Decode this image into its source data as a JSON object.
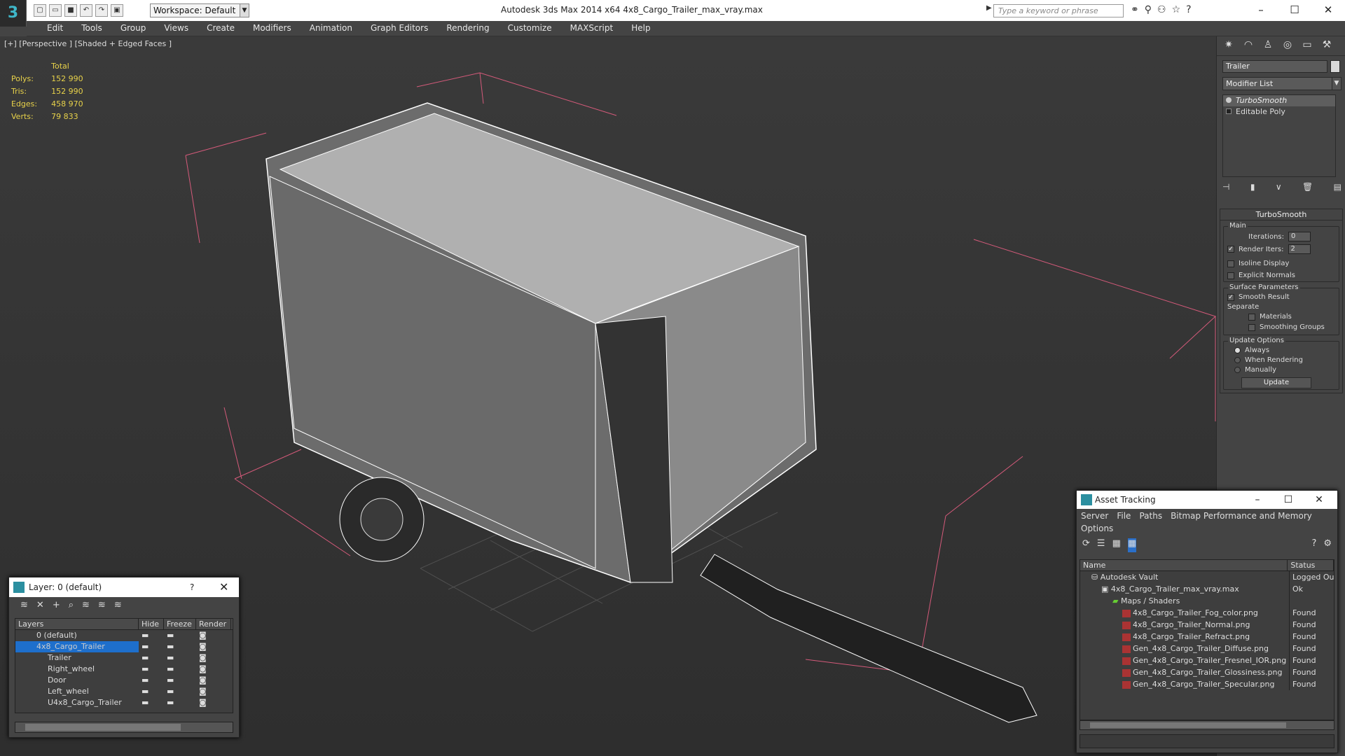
{
  "app": {
    "logo_glyph": "3",
    "title": "Autodesk 3ds Max  2014 x64      4x8_Cargo_Trailer_max_vray.max",
    "workspace": "Workspace: Default",
    "search_placeholder": "Type a keyword or phrase"
  },
  "menu": [
    "Edit",
    "Tools",
    "Group",
    "Views",
    "Create",
    "Modifiers",
    "Animation",
    "Graph Editors",
    "Rendering",
    "Customize",
    "MAXScript",
    "Help"
  ],
  "viewport": {
    "label": "[+] [Perspective ] [Shaded + Edged Faces ]",
    "stats": {
      "header": "Total",
      "rows": [
        {
          "label": "Polys:",
          "value": "152 990"
        },
        {
          "label": "Tris:",
          "value": "152 990"
        },
        {
          "label": "Edges:",
          "value": "458 970"
        },
        {
          "label": "Verts:",
          "value": "79 833"
        }
      ]
    }
  },
  "command_panel": {
    "object_name": "Trailer",
    "modifier_list": "Modifier List",
    "stack": [
      "TurboSmooth",
      "Editable Poly"
    ],
    "rollout_title": "TurboSmooth",
    "main_label": "Main",
    "iterations_label": "Iterations:",
    "iterations_value": "0",
    "render_iters_label": "Render Iters:",
    "render_iters_value": "2",
    "isoline_label": "Isoline Display",
    "explicit_normals_label": "Explicit Normals",
    "surface_params_label": "Surface Parameters",
    "smooth_result_label": "Smooth Result",
    "separate_label": "Separate",
    "materials_label": "Materials",
    "smoothing_groups_label": "Smoothing Groups",
    "update_options_label": "Update Options",
    "always_label": "Always",
    "when_rendering_label": "When Rendering",
    "manually_label": "Manually",
    "update_button": "Update"
  },
  "layer_dialog": {
    "title": "Layer: 0 (default)",
    "help_glyph": "?",
    "columns": [
      "Layers",
      "Hide",
      "Freeze",
      "Render"
    ],
    "rows": [
      {
        "name": "0 (default)",
        "indent": 1,
        "selected": false
      },
      {
        "name": "4x8_Cargo_Trailer",
        "indent": 1,
        "selected": true
      },
      {
        "name": "Trailer",
        "indent": 2,
        "selected": false
      },
      {
        "name": "Right_wheel",
        "indent": 2,
        "selected": false
      },
      {
        "name": "Door",
        "indent": 2,
        "selected": false
      },
      {
        "name": "Left_wheel",
        "indent": 2,
        "selected": false
      },
      {
        "name": "U4x8_Cargo_Trailer",
        "indent": 2,
        "selected": false
      }
    ]
  },
  "asset_tracking": {
    "title": "Asset Tracking",
    "menu": [
      "Server",
      "File",
      "Paths",
      "Bitmap Performance and Memory"
    ],
    "menu2": "Options",
    "columns": [
      "Name",
      "Status"
    ],
    "rows": [
      {
        "name": "Autodesk Vault",
        "status": "Logged Ou",
        "indent": 1
      },
      {
        "name": "4x8_Cargo_Trailer_max_vray.max",
        "status": "Ok",
        "indent": 2
      },
      {
        "name": "Maps / Shaders",
        "status": "",
        "indent": 3
      },
      {
        "name": "4x8_Cargo_Trailer_Fog_color.png",
        "status": "Found",
        "indent": 4
      },
      {
        "name": "4x8_Cargo_Trailer_Normal.png",
        "status": "Found",
        "indent": 4
      },
      {
        "name": "4x8_Cargo_Trailer_Refract.png",
        "status": "Found",
        "indent": 4
      },
      {
        "name": "Gen_4x8_Cargo_Trailer_Diffuse.png",
        "status": "Found",
        "indent": 4
      },
      {
        "name": "Gen_4x8_Cargo_Trailer_Fresnel_IOR.png",
        "status": "Found",
        "indent": 4
      },
      {
        "name": "Gen_4x8_Cargo_Trailer_Glossiness.png",
        "status": "Found",
        "indent": 4
      },
      {
        "name": "Gen_4x8_Cargo_Trailer_Specular.png",
        "status": "Found",
        "indent": 4
      }
    ]
  }
}
